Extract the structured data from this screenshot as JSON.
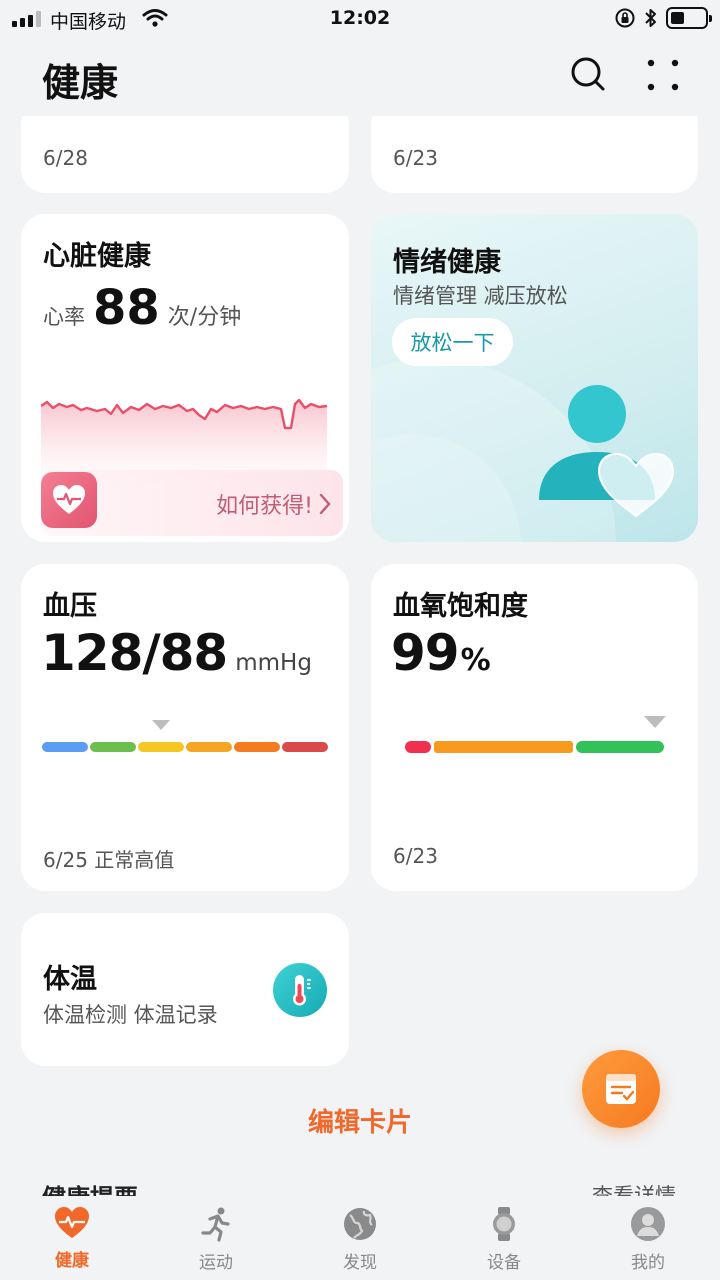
{
  "status_bar": {
    "carrier": "中国移动",
    "time": "12:02"
  },
  "header": {
    "title": "健康"
  },
  "top_cards": [
    {
      "date": "6/28"
    },
    {
      "date": "6/23"
    }
  ],
  "heart": {
    "title": "心脏健康",
    "rate_label": "心率",
    "rate_value": "88",
    "rate_unit": "次/分钟",
    "link": "如何获得!"
  },
  "mood": {
    "title": "情绪健康",
    "subtitle": "情绪管理 减压放松",
    "button": "放松一下"
  },
  "bp": {
    "title": "血压",
    "value": "128/88",
    "unit": "mmHg",
    "date": "6/25 正常高值"
  },
  "spo2": {
    "title": "血氧饱和度",
    "value": "99",
    "unit": "%",
    "date": "6/23"
  },
  "temp": {
    "title": "体温",
    "subtitle": "体温检测 体温记录"
  },
  "edit_cards": "编辑卡片",
  "section": {
    "title": "健康提要",
    "link": "查看详情"
  },
  "tabs": [
    {
      "label": "健康",
      "icon": "heart-pulse-icon",
      "active": true
    },
    {
      "label": "运动",
      "icon": "running-icon",
      "active": false
    },
    {
      "label": "发现",
      "icon": "globe-icon",
      "active": false
    },
    {
      "label": "设备",
      "icon": "watch-icon",
      "active": false
    },
    {
      "label": "我的",
      "icon": "profile-icon",
      "active": false
    }
  ],
  "colors": {
    "accent": "#f2682a",
    "heart": "#e8506a",
    "teal": "#1a9aa5"
  }
}
